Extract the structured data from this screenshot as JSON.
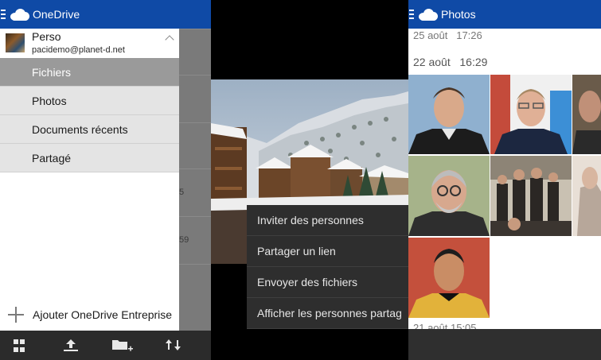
{
  "onedrive": {
    "app_title": "OneDrive",
    "account": {
      "name": "Perso",
      "email": "pacidemo@planet-d.net"
    },
    "menu": [
      {
        "label": "Fichiers",
        "active": true
      },
      {
        "label": "Photos",
        "active": false
      },
      {
        "label": "Documents récents",
        "active": false
      },
      {
        "label": "Partagé",
        "active": false
      }
    ],
    "add_business": "Ajouter OneDrive Entreprise",
    "background_fragments": [
      "5",
      "59"
    ],
    "bottom_icons": [
      "grid-view-icon",
      "upload-icon",
      "new-folder-icon",
      "sort-icon"
    ]
  },
  "context_menu": {
    "items": [
      "Inviter des personnes",
      "Partager un lien",
      "Envoyer des fichiers",
      "Afficher les personnes partag"
    ]
  },
  "photos": {
    "app_title": "Photos",
    "groups": [
      {
        "date": "25 août",
        "time": "17:26"
      },
      {
        "date": "22 août",
        "time": "16:29"
      }
    ],
    "bottom_fragment": "21 août 15:05"
  },
  "colors": {
    "header": "#0f4aa6",
    "active_item": "#9a9a9a",
    "context_menu": "#2e2e2e"
  }
}
